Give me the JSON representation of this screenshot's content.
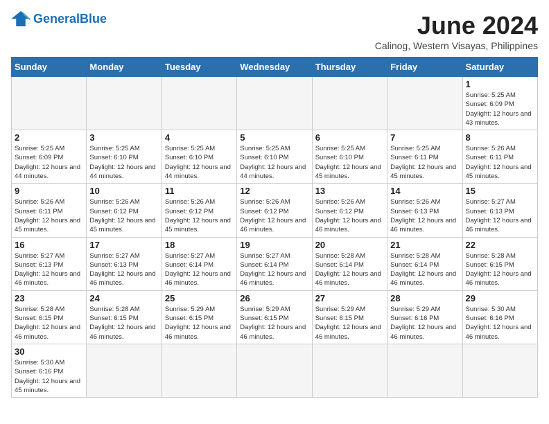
{
  "header": {
    "logo_general": "General",
    "logo_blue": "Blue",
    "title": "June 2024",
    "location": "Calinog, Western Visayas, Philippines"
  },
  "days_of_week": [
    "Sunday",
    "Monday",
    "Tuesday",
    "Wednesday",
    "Thursday",
    "Friday",
    "Saturday"
  ],
  "weeks": [
    [
      {
        "day": "",
        "info": ""
      },
      {
        "day": "",
        "info": ""
      },
      {
        "day": "",
        "info": ""
      },
      {
        "day": "",
        "info": ""
      },
      {
        "day": "",
        "info": ""
      },
      {
        "day": "",
        "info": ""
      },
      {
        "day": "1",
        "info": "Sunrise: 5:25 AM\nSunset: 6:09 PM\nDaylight: 12 hours and 43 minutes."
      }
    ],
    [
      {
        "day": "2",
        "info": "Sunrise: 5:25 AM\nSunset: 6:09 PM\nDaylight: 12 hours and 44 minutes."
      },
      {
        "day": "3",
        "info": "Sunrise: 5:25 AM\nSunset: 6:10 PM\nDaylight: 12 hours and 44 minutes."
      },
      {
        "day": "4",
        "info": "Sunrise: 5:25 AM\nSunset: 6:10 PM\nDaylight: 12 hours and 44 minutes."
      },
      {
        "day": "5",
        "info": "Sunrise: 5:25 AM\nSunset: 6:10 PM\nDaylight: 12 hours and 44 minutes."
      },
      {
        "day": "6",
        "info": "Sunrise: 5:25 AM\nSunset: 6:10 PM\nDaylight: 12 hours and 45 minutes."
      },
      {
        "day": "7",
        "info": "Sunrise: 5:25 AM\nSunset: 6:11 PM\nDaylight: 12 hours and 45 minutes."
      },
      {
        "day": "8",
        "info": "Sunrise: 5:26 AM\nSunset: 6:11 PM\nDaylight: 12 hours and 45 minutes."
      }
    ],
    [
      {
        "day": "9",
        "info": "Sunrise: 5:26 AM\nSunset: 6:11 PM\nDaylight: 12 hours and 45 minutes."
      },
      {
        "day": "10",
        "info": "Sunrise: 5:26 AM\nSunset: 6:12 PM\nDaylight: 12 hours and 45 minutes."
      },
      {
        "day": "11",
        "info": "Sunrise: 5:26 AM\nSunset: 6:12 PM\nDaylight: 12 hours and 45 minutes."
      },
      {
        "day": "12",
        "info": "Sunrise: 5:26 AM\nSunset: 6:12 PM\nDaylight: 12 hours and 46 minutes."
      },
      {
        "day": "13",
        "info": "Sunrise: 5:26 AM\nSunset: 6:12 PM\nDaylight: 12 hours and 46 minutes."
      },
      {
        "day": "14",
        "info": "Sunrise: 5:26 AM\nSunset: 6:13 PM\nDaylight: 12 hours and 46 minutes."
      },
      {
        "day": "15",
        "info": "Sunrise: 5:27 AM\nSunset: 6:13 PM\nDaylight: 12 hours and 46 minutes."
      }
    ],
    [
      {
        "day": "16",
        "info": "Sunrise: 5:27 AM\nSunset: 6:13 PM\nDaylight: 12 hours and 46 minutes."
      },
      {
        "day": "17",
        "info": "Sunrise: 5:27 AM\nSunset: 6:13 PM\nDaylight: 12 hours and 46 minutes."
      },
      {
        "day": "18",
        "info": "Sunrise: 5:27 AM\nSunset: 6:14 PM\nDaylight: 12 hours and 46 minutes."
      },
      {
        "day": "19",
        "info": "Sunrise: 5:27 AM\nSunset: 6:14 PM\nDaylight: 12 hours and 46 minutes."
      },
      {
        "day": "20",
        "info": "Sunrise: 5:28 AM\nSunset: 6:14 PM\nDaylight: 12 hours and 46 minutes."
      },
      {
        "day": "21",
        "info": "Sunrise: 5:28 AM\nSunset: 6:14 PM\nDaylight: 12 hours and 46 minutes."
      },
      {
        "day": "22",
        "info": "Sunrise: 5:28 AM\nSunset: 6:15 PM\nDaylight: 12 hours and 46 minutes."
      }
    ],
    [
      {
        "day": "23",
        "info": "Sunrise: 5:28 AM\nSunset: 6:15 PM\nDaylight: 12 hours and 46 minutes."
      },
      {
        "day": "24",
        "info": "Sunrise: 5:28 AM\nSunset: 6:15 PM\nDaylight: 12 hours and 46 minutes."
      },
      {
        "day": "25",
        "info": "Sunrise: 5:29 AM\nSunset: 6:15 PM\nDaylight: 12 hours and 46 minutes."
      },
      {
        "day": "26",
        "info": "Sunrise: 5:29 AM\nSunset: 6:15 PM\nDaylight: 12 hours and 46 minutes."
      },
      {
        "day": "27",
        "info": "Sunrise: 5:29 AM\nSunset: 6:15 PM\nDaylight: 12 hours and 46 minutes."
      },
      {
        "day": "28",
        "info": "Sunrise: 5:29 AM\nSunset: 6:16 PM\nDaylight: 12 hours and 46 minutes."
      },
      {
        "day": "29",
        "info": "Sunrise: 5:30 AM\nSunset: 6:16 PM\nDaylight: 12 hours and 46 minutes."
      }
    ],
    [
      {
        "day": "30",
        "info": "Sunrise: 5:30 AM\nSunset: 6:16 PM\nDaylight: 12 hours and 45 minutes."
      },
      {
        "day": "",
        "info": ""
      },
      {
        "day": "",
        "info": ""
      },
      {
        "day": "",
        "info": ""
      },
      {
        "day": "",
        "info": ""
      },
      {
        "day": "",
        "info": ""
      },
      {
        "day": "",
        "info": ""
      }
    ]
  ]
}
